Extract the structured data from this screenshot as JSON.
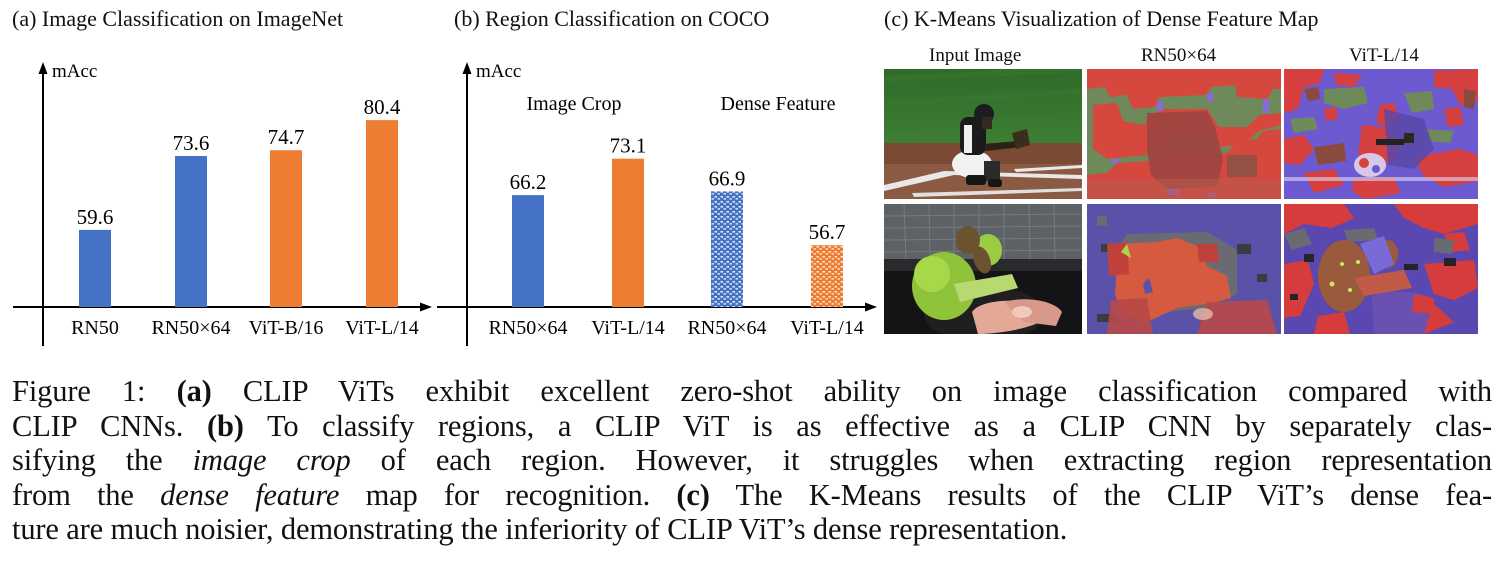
{
  "panels": {
    "a": {
      "title": "(a)  Image Classification on ImageNet"
    },
    "b": {
      "title": "(b)  Region Classification on COCO"
    },
    "c": {
      "title": "(c)   K-Means Visualization of Dense Feature Map",
      "column_titles": [
        "Input Image",
        "RN50×64",
        "ViT-L/14"
      ],
      "rows": [
        {
          "subject": "baseball catcher",
          "cells": [
            "input-photo",
            "rn50x64-kmeans",
            "vitl14-kmeans"
          ]
        },
        {
          "subject": "broccoli in hand",
          "cells": [
            "input-photo",
            "rn50x64-kmeans",
            "vitl14-kmeans"
          ]
        }
      ]
    }
  },
  "chart_data": [
    {
      "type": "bar",
      "title": "(a)  Image Classification on ImageNet",
      "ylabel": "mAcc",
      "xlabel": "",
      "categories": [
        "RN50",
        "RN50×64",
        "ViT-B/16",
        "ViT-L/14"
      ],
      "values": [
        59.6,
        73.6,
        74.7,
        80.4
      ],
      "value_labels": [
        "59.6",
        "73.6",
        "74.7",
        "80.4"
      ],
      "colors": [
        "#4472c4",
        "#4472c4",
        "#ed7d31",
        "#ed7d31"
      ],
      "patterns": [
        "solid",
        "solid",
        "solid",
        "solid"
      ],
      "ylim": [
        45,
        88
      ],
      "grid": false,
      "legend": "none"
    },
    {
      "type": "bar",
      "title": "(b)  Region Classification on COCO",
      "ylabel": "mAcc",
      "xlabel": "",
      "groups": [
        {
          "label": "Image Crop",
          "indices": [
            0,
            1
          ]
        },
        {
          "label": "Dense Feature",
          "indices": [
            2,
            3
          ]
        }
      ],
      "categories": [
        "RN50×64",
        "ViT-L/14",
        "RN50×64",
        "ViT-L/14"
      ],
      "values": [
        66.2,
        73.1,
        66.9,
        56.7
      ],
      "value_labels": [
        "66.2",
        "73.1",
        "66.9",
        "56.7"
      ],
      "colors": [
        "#4472c4",
        "#ed7d31",
        "#4472c4",
        "#ed7d31"
      ],
      "patterns": [
        "solid",
        "solid",
        "checker",
        "checker"
      ],
      "ylim": [
        45,
        88
      ],
      "grid": false,
      "legend": "none"
    }
  ],
  "caption": {
    "lines": [
      [
        {
          "t": "Figure 1: "
        },
        {
          "t": "(a)",
          "b": true
        },
        {
          "t": " CLIP ViTs exhibit excellent zero-shot ability on image classification compared with"
        }
      ],
      [
        {
          "t": "CLIP CNNs. "
        },
        {
          "t": "(b)",
          "b": true
        },
        {
          "t": " To classify regions, a CLIP ViT is as effective as a CLIP CNN by separately clas-"
        }
      ],
      [
        {
          "t": "sifying the "
        },
        {
          "t": "image crop",
          "i": true
        },
        {
          "t": " of each region.  However, it struggles when extracting region representation"
        }
      ],
      [
        {
          "t": "from the "
        },
        {
          "t": "dense feature",
          "i": true
        },
        {
          "t": " map for recognition. "
        },
        {
          "t": "(c)",
          "b": true
        },
        {
          "t": " The K-Means results of the CLIP ViT’s dense fea-"
        }
      ],
      [
        {
          "t": "ture are much noisier, demonstrating the inferiority of CLIP ViT’s dense representation."
        }
      ]
    ]
  }
}
